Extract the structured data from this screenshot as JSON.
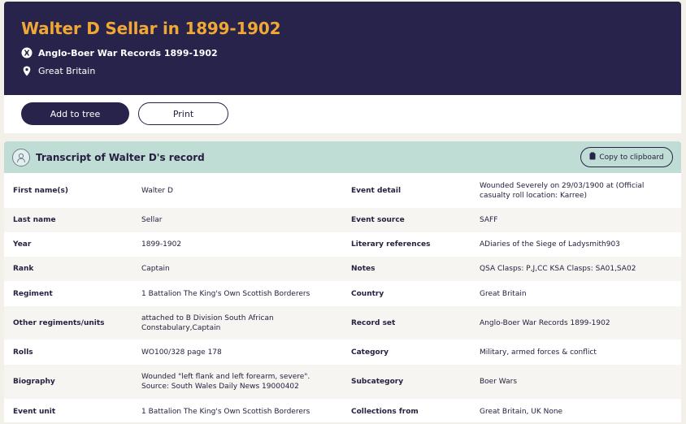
{
  "header": {
    "title": "Walter D Sellar in 1899-1902",
    "collection": "Anglo-Boer War Records 1899-1902",
    "location": "Great Britain"
  },
  "actions": {
    "add_to_tree": "Add to tree",
    "print": "Print"
  },
  "transcript": {
    "title": "Transcript of Walter D's record",
    "copy_label": "Copy to clipboard",
    "rows": [
      {
        "l1": "First name(s)",
        "v1": "Walter D",
        "l2": "Event detail",
        "v2": "Wounded Severely on 29/03/1900 at (Official casualty roll location: Karree)"
      },
      {
        "l1": "Last name",
        "v1": "Sellar",
        "l2": "Event source",
        "v2": "SAFF"
      },
      {
        "l1": "Year",
        "v1": "1899-1902",
        "l2": "Literary references",
        "v2": "ADiaries of the Siege of Ladysmith903"
      },
      {
        "l1": "Rank",
        "v1": "Captain",
        "l2": "Notes",
        "v2": "QSA Clasps: P,J,CC KSA Clasps: SA01,SA02"
      },
      {
        "l1": "Regiment",
        "v1": "1 Battalion The King's Own Scottish Borderers",
        "l2": "Country",
        "v2": "Great Britain"
      },
      {
        "l1": "Other regiments/units",
        "v1": "attached to B Division South African Constabulary,Captain",
        "l2": "Record set",
        "v2": "Anglo-Boer War Records 1899-1902"
      },
      {
        "l1": "Rolls",
        "v1": "WO100/328 page 178",
        "l2": "Category",
        "v2": "Military, armed forces & conflict"
      },
      {
        "l1": "Biography",
        "v1": "Wounded \"left flank and left forearm, severe\". Source: South Wales Daily News 19000402",
        "l2": "Subcategory",
        "v2": "Boer Wars"
      },
      {
        "l1": "Event unit",
        "v1": "1 Battalion The King's Own Scottish Borderers",
        "l2": "Collections from",
        "v2": "Great Britain, UK None"
      }
    ]
  },
  "colors": {
    "header_bg": "#27234a",
    "title_accent": "#f0a733",
    "panel_head_bg": "#bfdcd5",
    "page_bg": "#f3efe9"
  },
  "icons": {
    "collection": "war-records-badge-icon",
    "location": "map-pin-icon",
    "avatar": "person-portrait-icon",
    "copy": "clipboard-icon"
  }
}
